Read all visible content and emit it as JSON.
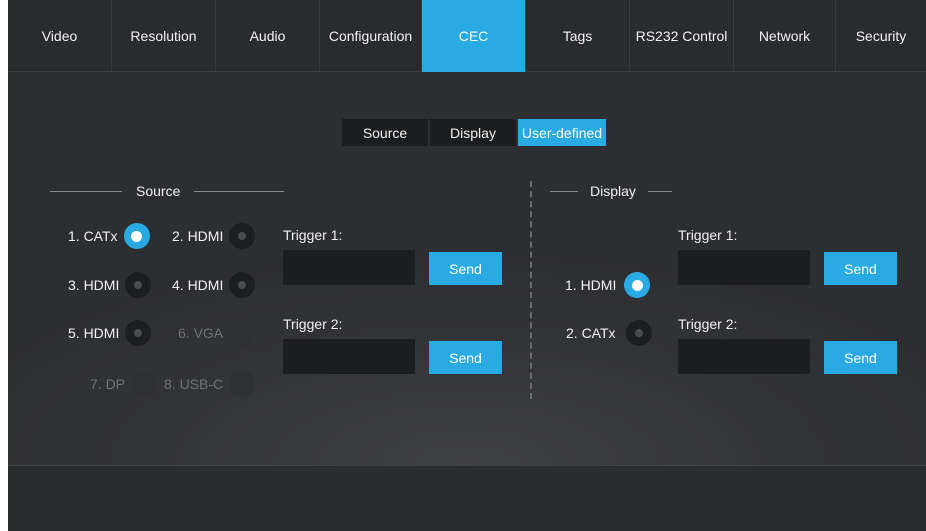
{
  "tabs": [
    {
      "label": "Video",
      "active": false
    },
    {
      "label": "Resolution",
      "active": false
    },
    {
      "label": "Audio",
      "active": false
    },
    {
      "label": "Configuration",
      "active": false
    },
    {
      "label": "CEC",
      "active": true
    },
    {
      "label": "Tags",
      "active": false
    },
    {
      "label": "RS232 Control",
      "active": false
    },
    {
      "label": "Network",
      "active": false
    },
    {
      "label": "Security",
      "active": false
    }
  ],
  "modes": [
    {
      "label": "Source",
      "active": false
    },
    {
      "label": "Display",
      "active": false
    },
    {
      "label": "User-defined",
      "active": true
    }
  ],
  "source": {
    "title": "Source",
    "inputs": [
      {
        "label": "1. CATx",
        "selected": true,
        "enabled": true
      },
      {
        "label": "2. HDMI",
        "selected": false,
        "enabled": true
      },
      {
        "label": "3. HDMI",
        "selected": false,
        "enabled": true
      },
      {
        "label": "4. HDMI",
        "selected": false,
        "enabled": true
      },
      {
        "label": "5. HDMI",
        "selected": false,
        "enabled": true
      },
      {
        "label": "6. VGA",
        "selected": false,
        "enabled": false
      },
      {
        "label": "7. DP",
        "selected": false,
        "enabled": false
      },
      {
        "label": "8. USB-C",
        "selected": false,
        "enabled": false
      }
    ],
    "trigger1_label": "Trigger 1:",
    "trigger1_value": "",
    "trigger2_label": "Trigger 2:",
    "trigger2_value": "",
    "send_label": "Send"
  },
  "display": {
    "title": "Display",
    "outputs": [
      {
        "label": "1. HDMI",
        "selected": true,
        "enabled": true
      },
      {
        "label": "2. CATx",
        "selected": false,
        "enabled": true
      }
    ],
    "trigger1_label": "Trigger 1:",
    "trigger1_value": "",
    "trigger2_label": "Trigger 2:",
    "trigger2_value": "",
    "send_label": "Send"
  },
  "colors": {
    "accent": "#29aae3",
    "background": "#2c2d30",
    "field": "#1c1d1f"
  }
}
